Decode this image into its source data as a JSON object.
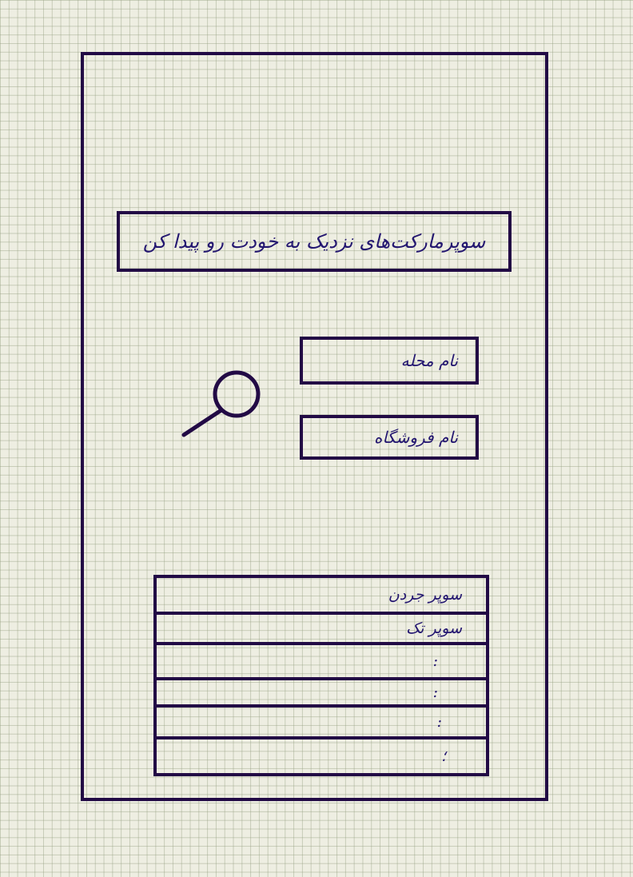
{
  "header": {
    "title": "سوپرمارکت‌های نزدیک به خودت رو پیدا کن"
  },
  "search": {
    "neighborhood_label": "نام محله",
    "store_label": "نام فروشگاه"
  },
  "results": {
    "rows": [
      {
        "label": "سوپر جردن"
      },
      {
        "label": "سوپر تک"
      },
      {
        "label": ":"
      },
      {
        "label": ":"
      },
      {
        "label": ":"
      },
      {
        "label": "؛"
      }
    ]
  }
}
